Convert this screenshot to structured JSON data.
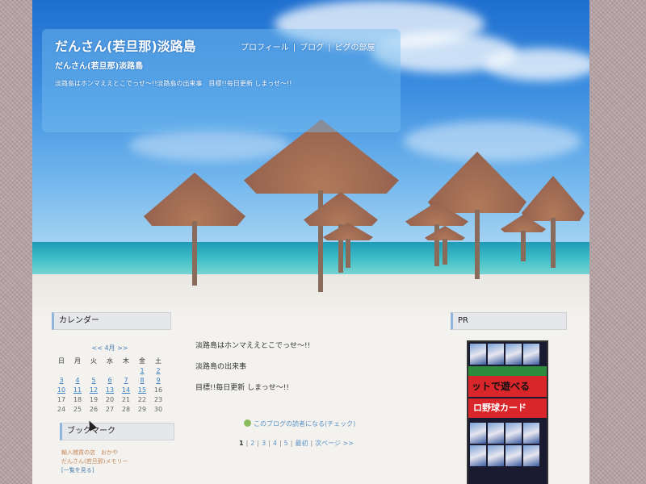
{
  "header": {
    "site_title": "だんさん(若旦那)淡路島",
    "nav": [
      "プロフィール",
      "ブログ",
      "ピグの部屋"
    ],
    "sub_title": "だんさん(若旦那)淡路島",
    "tagline": "淡路島はホンマええとこでっせ〜!!淡路島の出来事　目標!!毎日更新 しまっせ〜!!"
  },
  "sidebar_left": {
    "calendar_title": "カレンダー",
    "calendar_nav": "<< 4月 >>",
    "weekdays": [
      "日",
      "月",
      "火",
      "水",
      "木",
      "金",
      "土"
    ],
    "weeks": [
      [
        "",
        "",
        "",
        "",
        "",
        "1",
        "2"
      ],
      [
        "3",
        "4",
        "5",
        "6",
        "7",
        "8",
        "9"
      ],
      [
        "10",
        "11",
        "12",
        "13",
        "14",
        "15",
        "16"
      ],
      [
        "17",
        "18",
        "19",
        "20",
        "21",
        "22",
        "23"
      ],
      [
        "24",
        "25",
        "26",
        "27",
        "28",
        "29",
        "30"
      ]
    ],
    "bookmark_title": "ブックマーク",
    "bookmarks": [
      "輸入雑貨の店　おかや",
      "だんさん(若旦那)メモリー",
      "[一覧を見る]"
    ]
  },
  "main": {
    "post_lines": [
      "淡路島はホンマええとこでっせ〜!!",
      "淡路島の出来事",
      "目標!!毎日更新 しまっせ〜!!"
    ],
    "reader_link": "このブログの読者になる(チェック)",
    "pager": [
      "1",
      "2",
      "3",
      "4",
      "5",
      "最初",
      "次ページ >>"
    ]
  },
  "sidebar_right": {
    "pr_title": "PR",
    "banner_text_1": "ットで遊べる",
    "banner_text_2": "ロ野球カード"
  }
}
